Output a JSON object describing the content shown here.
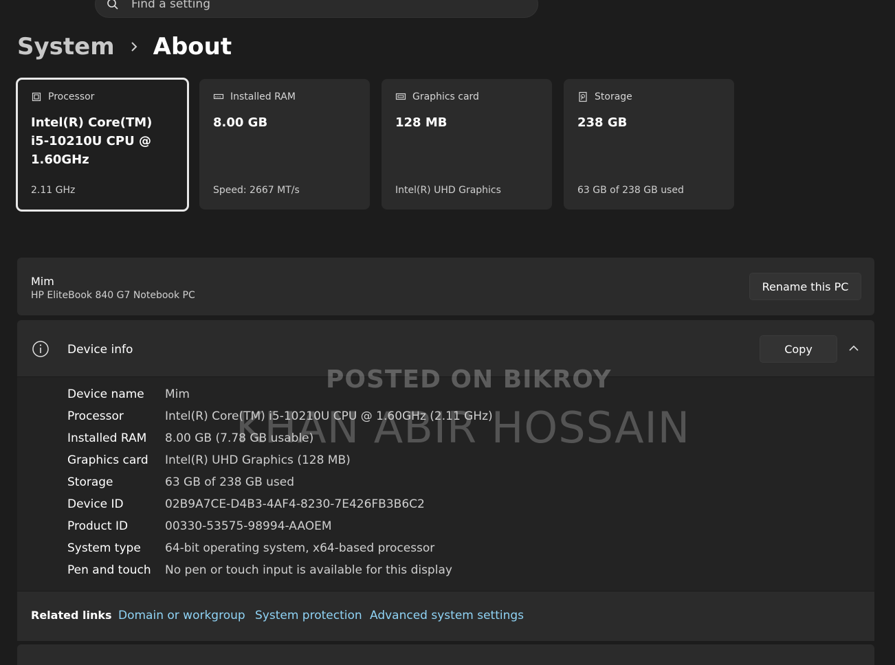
{
  "search": {
    "placeholder": "Find a setting"
  },
  "breadcrumb": {
    "parent": "System",
    "current": "About"
  },
  "cards": [
    {
      "label": "Processor",
      "value": "Intel(R) Core(TM) i5-10210U CPU @ 1.60GHz",
      "sub": "2.11 GHz",
      "icon": "processor-icon"
    },
    {
      "label": "Installed RAM",
      "value": "8.00 GB",
      "sub": "Speed: 2667 MT/s",
      "icon": "ram-icon"
    },
    {
      "label": "Graphics card",
      "value": "128 MB",
      "sub": "Intel(R) UHD Graphics",
      "icon": "graphics-card-icon"
    },
    {
      "label": "Storage",
      "value": "238 GB",
      "sub": "63 GB of 238 GB used",
      "icon": "storage-icon"
    }
  ],
  "pc": {
    "name": "Mim",
    "model": "HP EliteBook 840 G7 Notebook PC",
    "rename_label": "Rename this PC"
  },
  "device_info": {
    "title": "Device info",
    "copy_label": "Copy",
    "rows": [
      {
        "key": "Device name",
        "value": "Mim"
      },
      {
        "key": "Processor",
        "value": "Intel(R) Core(TM) i5-10210U CPU @ 1.60GHz (2.11 GHz)"
      },
      {
        "key": "Installed RAM",
        "value": "8.00 GB (7.78 GB usable)"
      },
      {
        "key": "Graphics card",
        "value": "Intel(R) UHD Graphics (128 MB)"
      },
      {
        "key": "Storage",
        "value": "63 GB of 238 GB used"
      },
      {
        "key": "Device ID",
        "value": "02B9A7CE-D4B3-4AF4-8230-7E426FB3B6C2"
      },
      {
        "key": "Product ID",
        "value": "00330-53575-98994-AAOEM"
      },
      {
        "key": "System type",
        "value": "64-bit operating system, x64-based processor"
      },
      {
        "key": "Pen and touch",
        "value": "No pen or touch input is available for this display"
      }
    ]
  },
  "related_links": {
    "label": "Related links",
    "links": [
      "Domain or workgroup",
      "System protection",
      "Advanced system settings"
    ]
  },
  "watermark": {
    "line1": "POSTED ON BIKROY",
    "line2": "KHAN ABIR HOSSAIN"
  },
  "colors": {
    "background": "#1c1c1c",
    "card": "#2b2b2b",
    "link": "#8fd3f5"
  }
}
